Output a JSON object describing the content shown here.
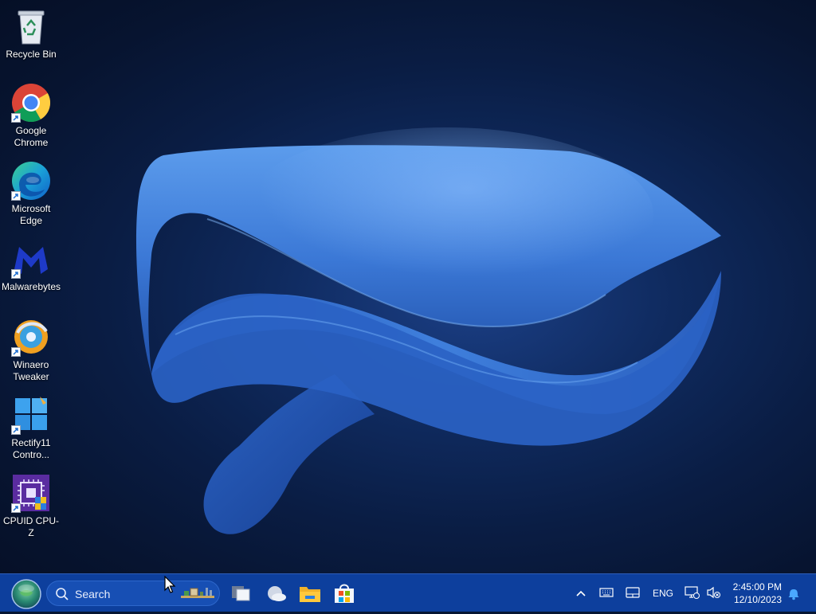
{
  "desktop": {
    "icons": [
      {
        "label": "Recycle Bin",
        "icon": "recycle-bin-icon",
        "shortcut": false
      },
      {
        "label": "Google Chrome",
        "icon": "chrome-icon",
        "shortcut": true
      },
      {
        "label": "Microsoft Edge",
        "icon": "edge-icon",
        "shortcut": true
      },
      {
        "label": "Malwarebytes",
        "icon": "malwarebytes-icon",
        "shortcut": true
      },
      {
        "label": "Winaero Tweaker",
        "icon": "winaero-tweaker-icon",
        "shortcut": true
      },
      {
        "label": "Rectify11 Contro...",
        "icon": "rectify11-icon",
        "shortcut": true
      },
      {
        "label": "CPUID CPU-Z",
        "icon": "cpuz-icon",
        "shortcut": true
      }
    ]
  },
  "taskbar": {
    "start_icon": "start-orb-icon",
    "search": {
      "label": "Search",
      "icon": "search-icon"
    },
    "apps": [
      {
        "name": "Task View",
        "icon": "task-view-icon"
      },
      {
        "name": "Widgets",
        "icon": "weather-icon"
      },
      {
        "name": "File Explorer",
        "icon": "file-explorer-icon"
      },
      {
        "name": "Microsoft Store",
        "icon": "store-icon"
      }
    ],
    "tray": {
      "language": "ENG",
      "clock": {
        "time": "2:45:00 PM",
        "date": "12/10/2023"
      }
    }
  },
  "colors": {
    "taskbar": "#0d3f9d",
    "desktop_bg": "#0a1d44",
    "wallpaper_ribbon": "#3a7ad8"
  }
}
